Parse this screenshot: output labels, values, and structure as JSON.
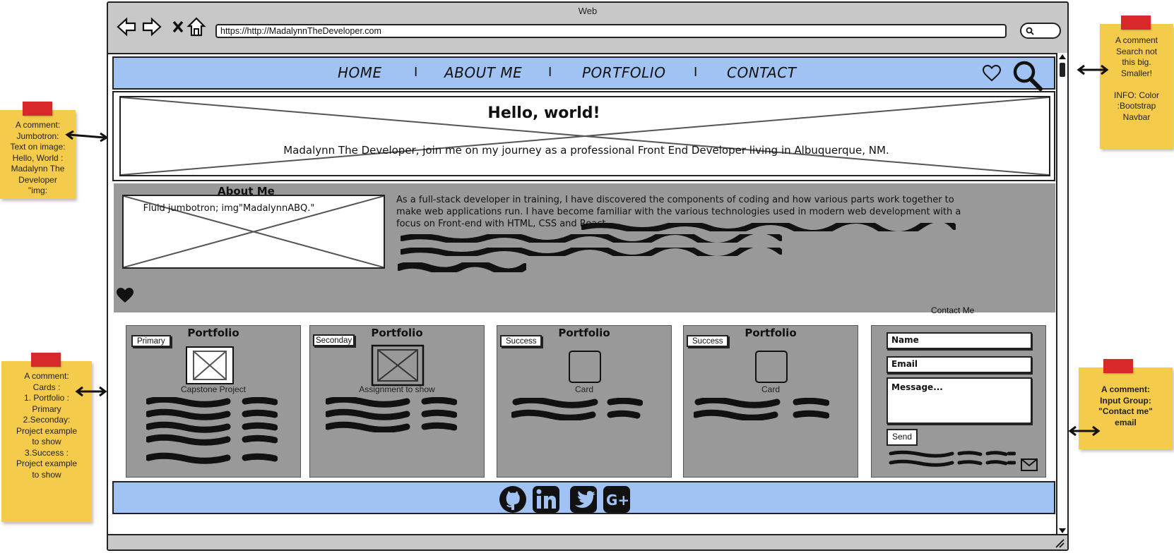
{
  "browser": {
    "window_title": "Web",
    "url": "https://http://MadalynnTheDeveloper.com"
  },
  "nav": {
    "links": [
      "HOME",
      "ABOUT ME",
      "PORTFOLIO",
      "CONTACT"
    ],
    "separator": "I"
  },
  "jumbotron": {
    "title": "Hello, world!",
    "subtitle": "Madalynn The Developer, join me on my journey as a professional Front End Developer living in Albuquerque, NM."
  },
  "about": {
    "title": "About Me",
    "image_label": "Fluid jumbotron; img\"MadalynnABQ.\"",
    "text": "As a full-stack developer in training, I have discovered the components of coding and how various parts work together to make web applications run. I have become familiar with the various technologies used in modern web development with a focus on Front-end with HTML, CSS and React."
  },
  "cards": [
    {
      "badge": "Primary",
      "title": "Portfolio",
      "caption": "Capstone Project"
    },
    {
      "badge": "Seconday",
      "title": "Portfolio",
      "caption": "Assignment to show"
    },
    {
      "badge": "Success",
      "title": "Portfolio",
      "caption": "Card"
    },
    {
      "badge": "Success",
      "title": "Portfolio",
      "caption": "Card"
    }
  ],
  "contact": {
    "label": "Contact Me",
    "name_placeholder": "Name",
    "email_placeholder": "Email",
    "message_placeholder": "Message...",
    "send_label": "Send"
  },
  "footer": {
    "icons": [
      "github-icon",
      "linkedin-icon",
      "twitter-icon",
      "google-plus-icon"
    ]
  },
  "notes": {
    "top_right": "A comment\nSearch not\nthis big.\nSmaller!\n\nINFO: Color\n:Bootstrap\nNavbar",
    "left_mid": "A comment:\nJumbotron:\nText on image:\nHello, World :\nMadalynn The\nDeveloper\n\"img:",
    "left_bottom": "A comment:\nCards :\n1. Portfolio :\nPrimary\n2.Seconday:\nProject example\nto show\n3.Success :\nProject  example\nto show",
    "right_bottom": "A comment:\nInput Group:\n\"Contact me\"\nemail"
  },
  "colors": {
    "nav_blue": "#a0c3f3",
    "panel_gray": "#999999",
    "note_yellow": "#f5cb4b",
    "tape_red": "#d8282a"
  }
}
